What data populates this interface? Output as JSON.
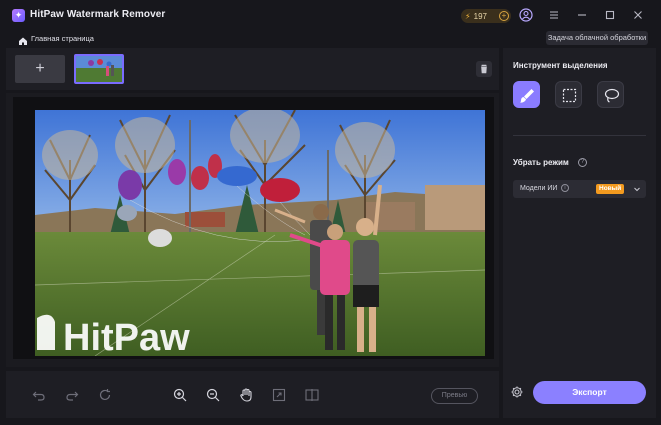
{
  "app": {
    "title": "HitPaw Watermark Remover",
    "credits": "197"
  },
  "breadcrumb": {
    "home_label": "Главная страница"
  },
  "header": {
    "cloud_task_label": "Задача облачной обработки"
  },
  "thumbnails": {
    "add_label": "+"
  },
  "canvas": {
    "watermark_text": "HitPaw"
  },
  "bottom_toolbar": {
    "preview_label": "Превью"
  },
  "right_panel": {
    "selection_tool_title": "Инструмент выделения",
    "remove_mode_title": "Убрать режим",
    "mode_select": {
      "value": "Модели ИИ",
      "badge": "Новый"
    },
    "export_label": "Экспорт"
  },
  "colors": {
    "accent": "#8b80ff",
    "badge": "#f39a1f",
    "credits": "#f6b73c"
  }
}
